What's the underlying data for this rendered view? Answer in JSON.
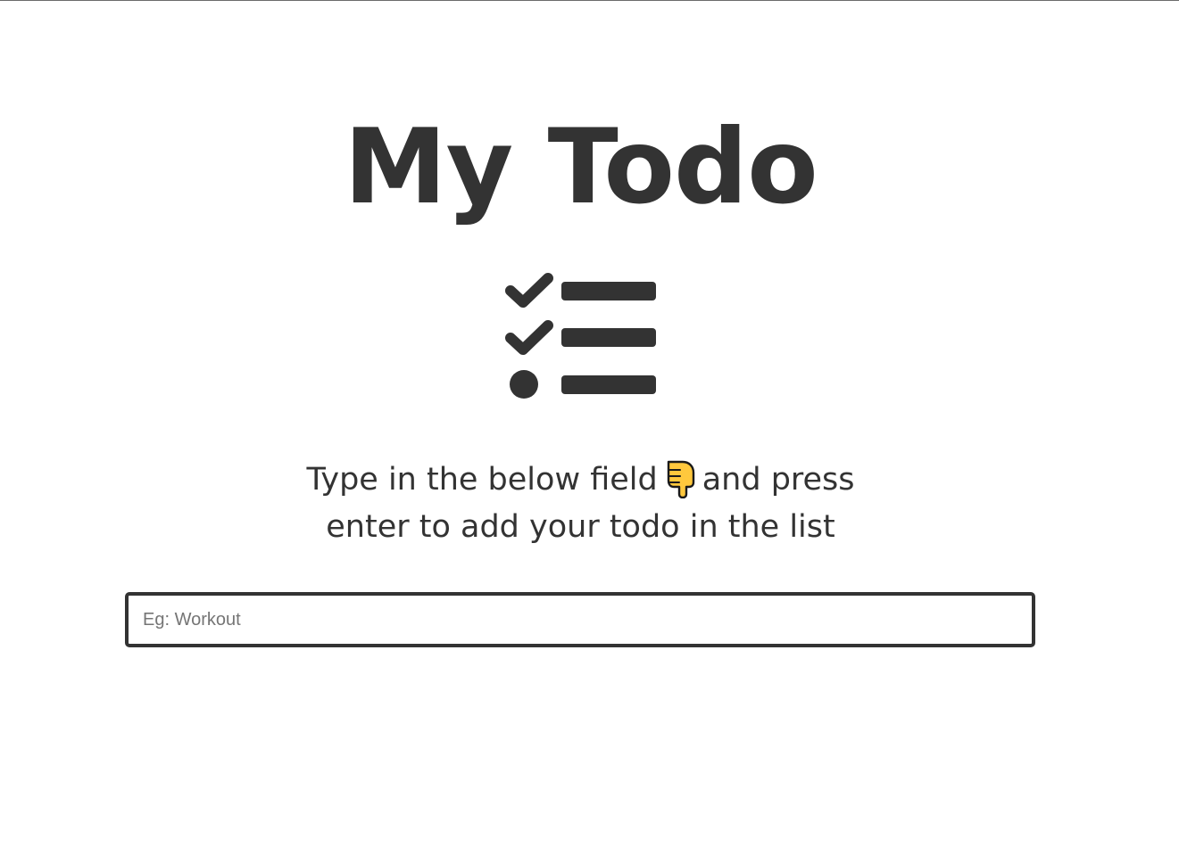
{
  "header": {
    "title": "My Todo"
  },
  "icons": {
    "checklist": "checklist-icon",
    "pointer": "pointing-down-hand-icon"
  },
  "instructions": {
    "line1_before": "Type in the below field",
    "line1_after": "and press",
    "line2": "enter to add your todo in the list"
  },
  "todo_input": {
    "value": "",
    "placeholder": "Eg: Workout"
  },
  "colors": {
    "text": "#333333",
    "icon": "#333333",
    "pointer_fill": "#FFC83D",
    "background": "#ffffff"
  }
}
